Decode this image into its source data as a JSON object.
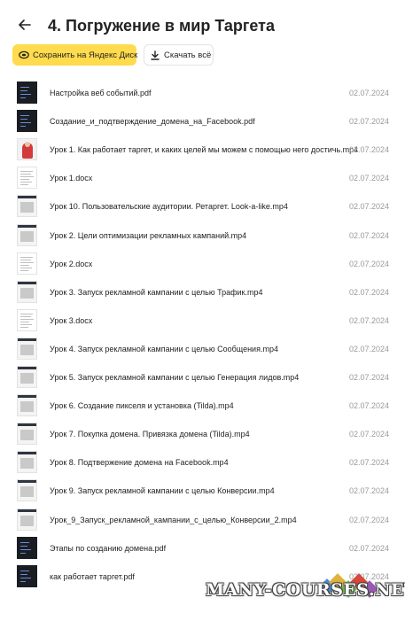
{
  "header": {
    "title": "4. Погружение в мир Таргета"
  },
  "toolbar": {
    "save_label": "Сохранить на Яндекс Диск",
    "download_label": "Скачать всё"
  },
  "files": [
    {
      "name": "Настройка веб событий.pdf",
      "date": "02.07.2024",
      "thumb": "dark"
    },
    {
      "name": "Создание_и_подтверждение_домена_на_Facebook.pdf",
      "date": "02.07.2024",
      "thumb": "dark"
    },
    {
      "name": "Урок 1. Как работает таргет, и каких целей мы можем с помощью него достичь.mp4",
      "date": "02.07.2024",
      "thumb": "red"
    },
    {
      "name": "Урок 1.docx",
      "date": "02.07.2024",
      "thumb": "doc"
    },
    {
      "name": "Урок 10. Пользовательские аудитории. Ретаргет. Look-a-like.mp4",
      "date": "02.07.2024",
      "thumb": "shot"
    },
    {
      "name": "Урок 2. Цели оптимизации рекламных кампаний.mp4",
      "date": "02.07.2024",
      "thumb": "shot"
    },
    {
      "name": "Урок 2.docx",
      "date": "02.07.2024",
      "thumb": "doc"
    },
    {
      "name": "Урок 3. Запуск рекламной кампании с целью Трафик.mp4",
      "date": "02.07.2024",
      "thumb": "shot"
    },
    {
      "name": "Урок 3.docx",
      "date": "02.07.2024",
      "thumb": "doc"
    },
    {
      "name": "Урок 4. Запуск рекламной кампании с целью Сообщения.mp4",
      "date": "02.07.2024",
      "thumb": "shot"
    },
    {
      "name": "Урок 5. Запуск рекламной кампании с целью Генерация лидов.mp4",
      "date": "02.07.2024",
      "thumb": "shot"
    },
    {
      "name": "Урок 6. Создание пикселя и установка (Tilda).mp4",
      "date": "02.07.2024",
      "thumb": "shot"
    },
    {
      "name": "Урок 7. Покупка домена. Привязка домена (Tilda).mp4",
      "date": "02.07.2024",
      "thumb": "shot"
    },
    {
      "name": "Урок 8. Подтвержение домена на Facebook.mp4",
      "date": "02.07.2024",
      "thumb": "shot"
    },
    {
      "name": "Урок 9. Запуск рекламной кампании с целью Конверсии.mp4",
      "date": "02.07.2024",
      "thumb": "shot"
    },
    {
      "name": "Урок_9_Запуск_рекламной_кампании_с_целью_Конверсии_2.mp4",
      "date": "02.07.2024",
      "thumb": "shot"
    },
    {
      "name": "Этапы по созданию домена.pdf",
      "date": "02.07.2024",
      "thumb": "dark"
    },
    {
      "name": "как работает таргет.pdf",
      "date": "02.07.2024",
      "thumb": "dark"
    }
  ],
  "watermark": {
    "text": "MANY-COURSES.NET"
  },
  "colors": {
    "accent": "#ffdb4d",
    "date": "#9a9a9a"
  },
  "icons": {
    "back": "arrow-left-icon",
    "save": "yandex-disk-icon",
    "download": "download-icon"
  }
}
